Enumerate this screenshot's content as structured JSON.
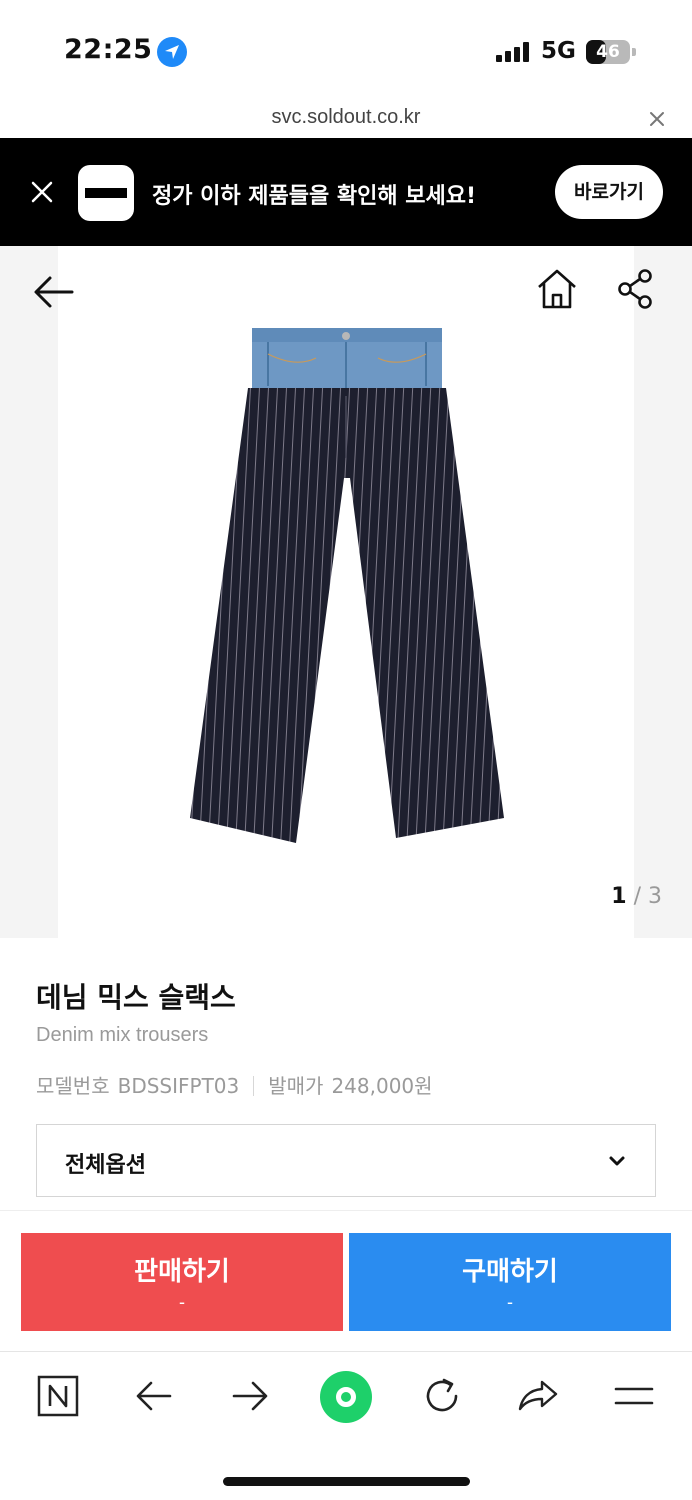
{
  "status": {
    "time": "22:25",
    "network": "5G",
    "battery": "46",
    "battery_level": 0.46,
    "icons": [
      "location-arrow-icon",
      "signal-bars-icon",
      "battery-icon"
    ]
  },
  "browser": {
    "url": "svc.soldout.co.kr",
    "icons": [
      "close-icon"
    ]
  },
  "banner": {
    "text": "정가 이하 제품들을 확인해 보세요!",
    "button": "바로가기",
    "icons": [
      "close-icon",
      "soldout-logo-icon"
    ],
    "background": "#000000"
  },
  "product": {
    "icons": [
      "back-arrow-icon",
      "home-icon",
      "share-icon"
    ],
    "image_counter": {
      "current": "1",
      "separator": "/",
      "total": "3"
    },
    "title_ko": "데님 믹스 슬랙스",
    "title_en": "Denim mix trousers",
    "model_label": "모델번호",
    "model_value": "BDSSIFPT03",
    "release_label": "발매가",
    "release_value": "248,000원",
    "option_label": "전체옵션"
  },
  "actions": {
    "sell": {
      "label": "판매하기",
      "price": "-",
      "color": "#ef4d4f"
    },
    "buy": {
      "label": "구매하기",
      "price": "-",
      "color": "#2a8cf0"
    }
  },
  "toolbar": {
    "icons": [
      "naver-n-icon",
      "back-icon",
      "forward-icon",
      "green-dot-icon",
      "refresh-icon",
      "share-arrow-icon",
      "menu-icon"
    ]
  }
}
